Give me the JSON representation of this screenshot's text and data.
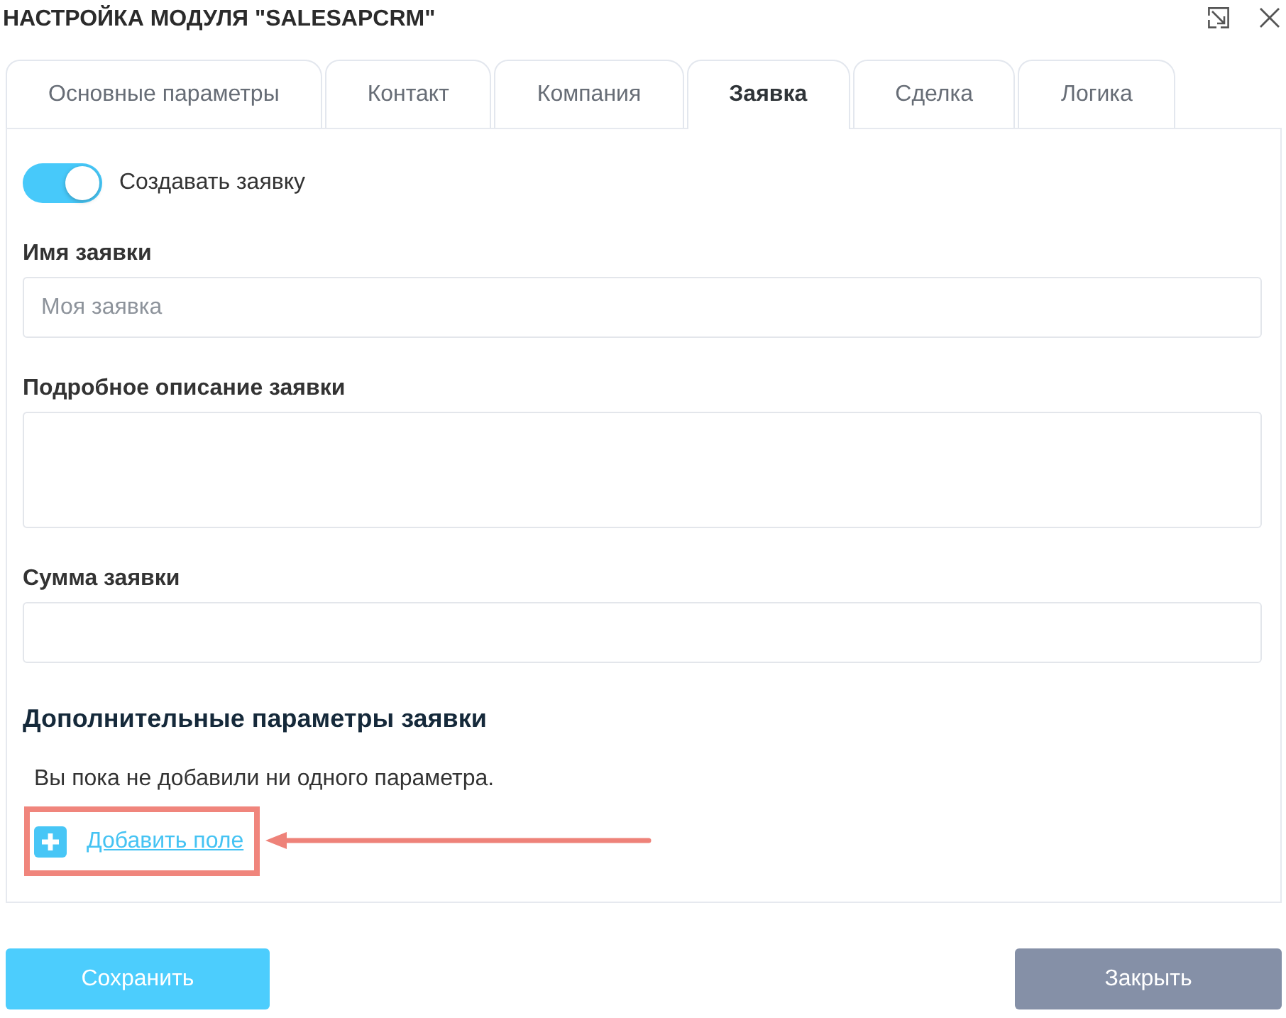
{
  "dialog": {
    "title": "НАСТРОЙКА МОДУЛЯ \"SALESAPCRM\""
  },
  "tabs": [
    {
      "label": "Основные параметры",
      "selected": false
    },
    {
      "label": "Контакт",
      "selected": false
    },
    {
      "label": "Компания",
      "selected": false
    },
    {
      "label": "Заявка",
      "selected": true
    },
    {
      "label": "Сделка",
      "selected": false
    },
    {
      "label": "Логика",
      "selected": false
    }
  ],
  "create_toggle": {
    "label": "Создавать заявку",
    "on": true
  },
  "fields": [
    {
      "kind": "input",
      "label": "Имя заявки",
      "placeholder": "Моя заявка"
    },
    {
      "kind": "textarea",
      "label": "Подробное описание заявки"
    },
    {
      "kind": "input",
      "label": "Сумма заявки"
    }
  ],
  "extra_params": {
    "heading": "Дополнительные параметры заявки",
    "empty_message": "Вы пока не добавили ни одного параметра.",
    "add_link": "Добавить поле"
  },
  "buttons": [
    {
      "kind": "primary",
      "label": "Сохранить"
    },
    {
      "kind": "secondary",
      "label": "Закрыть"
    }
  ]
}
